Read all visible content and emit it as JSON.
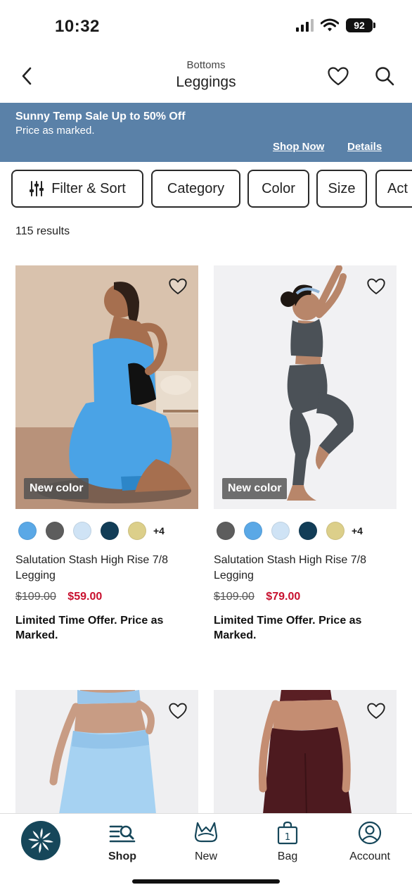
{
  "status": {
    "time": "10:32",
    "battery": "92"
  },
  "header": {
    "subtitle": "Bottoms",
    "title": "Leggings"
  },
  "promo": {
    "title": "Sunny Temp Sale Up to 50% Off",
    "subtitle": "Price as marked.",
    "shop_now": "Shop Now",
    "details": "Details",
    "background": "#5a81a8"
  },
  "filters": [
    "Filter & Sort",
    "Category",
    "Color",
    "Size",
    "Act"
  ],
  "results_count": "115 results",
  "products": [
    {
      "badge": "New color",
      "swatches": [
        "#5aa8e6",
        "#5d5d5d",
        "#cfe3f5",
        "#123d57",
        "#dccf8a"
      ],
      "more_colors": "+4",
      "name": "Salutation Stash High Rise 7/8 Legging",
      "original_price": "$109.00",
      "sale_price": "$59.00",
      "offer": "Limited Time Offer. Price as Marked."
    },
    {
      "badge": "New color",
      "swatches": [
        "#5d5d5d",
        "#5aa8e6",
        "#cfe3f5",
        "#123d57",
        "#dccf8a"
      ],
      "more_colors": "+4",
      "name": "Salutation Stash High Rise 7/8 Legging",
      "original_price": "$109.00",
      "sale_price": "$79.00",
      "offer": "Limited Time Offer. Price as Marked."
    }
  ],
  "tabs": [
    {
      "label": "Shop",
      "icon": "shop-search-icon",
      "active": true
    },
    {
      "label": "New",
      "icon": "sports-bra-icon"
    },
    {
      "label": "Bag",
      "icon": "bag-icon",
      "count": "1"
    },
    {
      "label": "Account",
      "icon": "account-icon"
    }
  ],
  "colors": {
    "sale_red": "#c8102e",
    "brand_teal": "#16475a"
  }
}
